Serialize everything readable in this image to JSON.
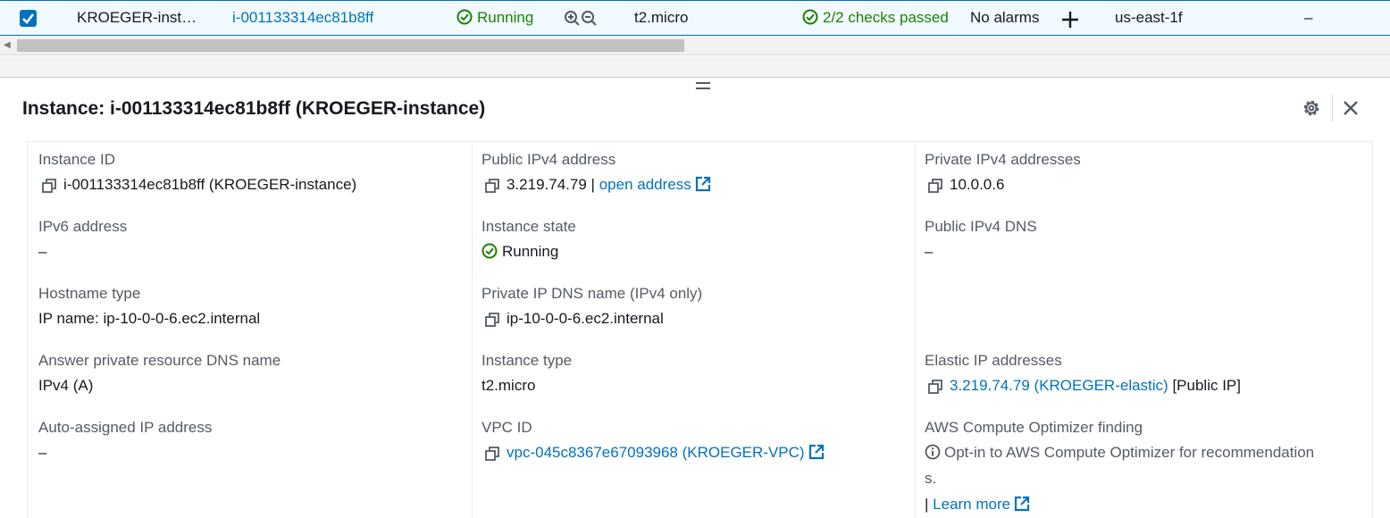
{
  "table_row": {
    "name": "KROEGER-inst…",
    "instance_id": "i-001133314ec81b8ff",
    "state": "Running",
    "type": "t2.micro",
    "status_check": "2/2 checks passed",
    "alarms": "No alarms",
    "az": "us-east-1f",
    "last": "–"
  },
  "details": {
    "title": "Instance: i-001133314ec81b8ff (KROEGER-instance)",
    "col1": {
      "instance_id_label": "Instance ID",
      "instance_id_value": "i-001133314ec81b8ff (KROEGER-instance)",
      "ipv6_label": "IPv6 address",
      "ipv6_value": "–",
      "hostname_type_label": "Hostname type",
      "hostname_type_value": "IP name: ip-10-0-0-6.ec2.internal",
      "answer_dns_label": "Answer private resource DNS name",
      "answer_dns_value": "IPv4 (A)",
      "auto_ip_label": "Auto-assigned IP address",
      "auto_ip_value": "–"
    },
    "col2": {
      "public_ipv4_label": "Public IPv4 address",
      "public_ipv4_value": "3.219.74.79",
      "public_ipv4_sep": "|",
      "open_address": "open address",
      "state_label": "Instance state",
      "state_value": "Running",
      "private_dns_label": "Private IP DNS name (IPv4 only)",
      "private_dns_value": "ip-10-0-0-6.ec2.internal",
      "type_label": "Instance type",
      "type_value": "t2.micro",
      "vpc_label": "VPC ID",
      "vpc_value": "vpc-045c8367e67093968 (KROEGER-VPC)"
    },
    "col3": {
      "private_ipv4_label": "Private IPv4 addresses",
      "private_ipv4_value": "10.0.0.6",
      "public_dns_label": "Public IPv4 DNS",
      "public_dns_value": "–",
      "elastic_label": "Elastic IP addresses",
      "elastic_value": "3.219.74.79 (KROEGER-elastic)",
      "elastic_suffix": "[Public IP]",
      "optimizer_label": "AWS Compute Optimizer finding",
      "optimizer_line1": "Opt-in to AWS Compute Optimizer for recommendation",
      "optimizer_line2": "s.",
      "learn_sep": "|",
      "learn_more": "Learn more"
    }
  },
  "colors": {
    "link": "#0073bb",
    "success": "#1d8102",
    "selected_row_bg": "#f1faff"
  },
  "icons": [
    "checkbox-checked-icon",
    "status-ok-icon",
    "zoom-in-icon",
    "zoom-out-icon",
    "plus-icon",
    "drag-handle-icon",
    "gear-icon",
    "close-icon",
    "copy-icon",
    "external-link-icon",
    "info-icon"
  ]
}
